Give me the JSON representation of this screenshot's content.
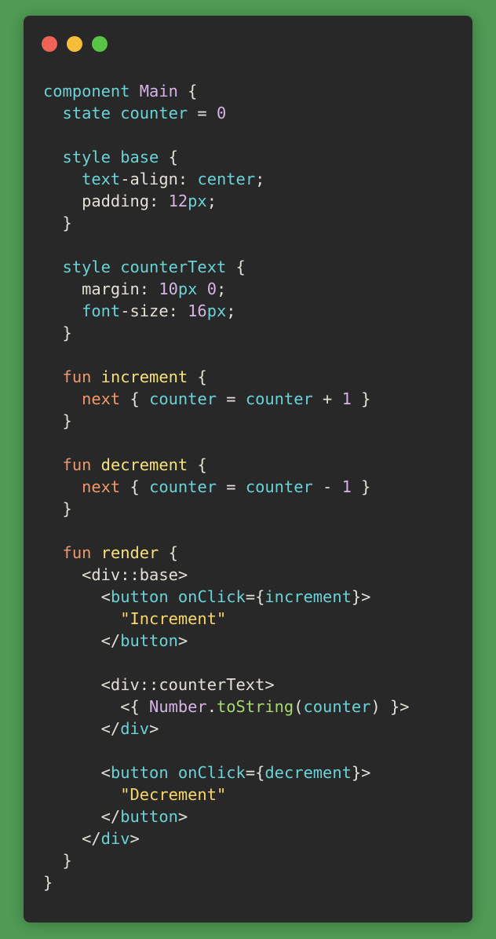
{
  "window": {
    "controls": [
      {
        "name": "close",
        "color": "#ef6257"
      },
      {
        "name": "minimize",
        "color": "#f6bd3a"
      },
      {
        "name": "maximize",
        "color": "#59c545"
      }
    ]
  },
  "code": {
    "language": "mint",
    "lines": [
      [
        {
          "t": "component ",
          "c": "kw"
        },
        {
          "t": "Main",
          "c": "type"
        },
        {
          "t": " {",
          "c": "plain"
        }
      ],
      [
        {
          "t": "  state ",
          "c": "kw"
        },
        {
          "t": "counter",
          "c": "var"
        },
        {
          "t": " = ",
          "c": "plain"
        },
        {
          "t": "0",
          "c": "num"
        }
      ],
      [],
      [
        {
          "t": "  style ",
          "c": "kw"
        },
        {
          "t": "base",
          "c": "var"
        },
        {
          "t": " {",
          "c": "plain"
        }
      ],
      [
        {
          "t": "    text",
          "c": "prop2"
        },
        {
          "t": "-align: ",
          "c": "plain"
        },
        {
          "t": "center",
          "c": "kw"
        },
        {
          "t": ";",
          "c": "plain"
        }
      ],
      [
        {
          "t": "    padding: ",
          "c": "plain"
        },
        {
          "t": "12",
          "c": "num"
        },
        {
          "t": "px",
          "c": "unit"
        },
        {
          "t": ";",
          "c": "plain"
        }
      ],
      [
        {
          "t": "  }",
          "c": "plain"
        }
      ],
      [],
      [
        {
          "t": "  style ",
          "c": "kw"
        },
        {
          "t": "counterText",
          "c": "var"
        },
        {
          "t": " {",
          "c": "plain"
        }
      ],
      [
        {
          "t": "    margin: ",
          "c": "plain"
        },
        {
          "t": "10",
          "c": "num"
        },
        {
          "t": "px",
          "c": "unit"
        },
        {
          "t": " ",
          "c": "plain"
        },
        {
          "t": "0",
          "c": "num"
        },
        {
          "t": ";",
          "c": "plain"
        }
      ],
      [
        {
          "t": "    font",
          "c": "prop2"
        },
        {
          "t": "-size: ",
          "c": "plain"
        },
        {
          "t": "16",
          "c": "num"
        },
        {
          "t": "px",
          "c": "unit"
        },
        {
          "t": ";",
          "c": "plain"
        }
      ],
      [
        {
          "t": "  }",
          "c": "plain"
        }
      ],
      [],
      [
        {
          "t": "  fun ",
          "c": "kw2"
        },
        {
          "t": "increment",
          "c": "fn"
        },
        {
          "t": " {",
          "c": "plain"
        }
      ],
      [
        {
          "t": "    next",
          "c": "kw2"
        },
        {
          "t": " { ",
          "c": "plain"
        },
        {
          "t": "counter",
          "c": "var"
        },
        {
          "t": " = ",
          "c": "plain"
        },
        {
          "t": "counter",
          "c": "var"
        },
        {
          "t": " + ",
          "c": "plain"
        },
        {
          "t": "1",
          "c": "num"
        },
        {
          "t": " }",
          "c": "plain"
        }
      ],
      [
        {
          "t": "  }",
          "c": "plain"
        }
      ],
      [],
      [
        {
          "t": "  fun ",
          "c": "kw2"
        },
        {
          "t": "decrement",
          "c": "fn"
        },
        {
          "t": " {",
          "c": "plain"
        }
      ],
      [
        {
          "t": "    next",
          "c": "kw2"
        },
        {
          "t": " { ",
          "c": "plain"
        },
        {
          "t": "counter",
          "c": "var"
        },
        {
          "t": " = ",
          "c": "plain"
        },
        {
          "t": "counter",
          "c": "var"
        },
        {
          "t": " - ",
          "c": "plain"
        },
        {
          "t": "1",
          "c": "num"
        },
        {
          "t": " }",
          "c": "plain"
        }
      ],
      [
        {
          "t": "  }",
          "c": "plain"
        }
      ],
      [],
      [
        {
          "t": "  fun ",
          "c": "kw2"
        },
        {
          "t": "render",
          "c": "fn"
        },
        {
          "t": " {",
          "c": "plain"
        }
      ],
      [
        {
          "t": "    <div::base>",
          "c": "plain"
        }
      ],
      [
        {
          "t": "      <",
          "c": "plain"
        },
        {
          "t": "button",
          "c": "tag"
        },
        {
          "t": " ",
          "c": "plain"
        },
        {
          "t": "onClick",
          "c": "attr"
        },
        {
          "t": "={",
          "c": "plain"
        },
        {
          "t": "increment",
          "c": "var"
        },
        {
          "t": "}>",
          "c": "plain"
        }
      ],
      [
        {
          "t": "        \"Increment\"",
          "c": "str"
        }
      ],
      [
        {
          "t": "      </",
          "c": "plain"
        },
        {
          "t": "button",
          "c": "tag"
        },
        {
          "t": ">",
          "c": "plain"
        }
      ],
      [],
      [
        {
          "t": "      <div::counterText>",
          "c": "plain"
        }
      ],
      [
        {
          "t": "        <{ ",
          "c": "plain"
        },
        {
          "t": "Number",
          "c": "type"
        },
        {
          "t": ".",
          "c": "plain"
        },
        {
          "t": "toString",
          "c": "method"
        },
        {
          "t": "(",
          "c": "plain"
        },
        {
          "t": "counter",
          "c": "var"
        },
        {
          "t": ") }>",
          "c": "plain"
        }
      ],
      [
        {
          "t": "      </",
          "c": "plain"
        },
        {
          "t": "div",
          "c": "tag"
        },
        {
          "t": ">",
          "c": "plain"
        }
      ],
      [],
      [
        {
          "t": "      <",
          "c": "plain"
        },
        {
          "t": "button",
          "c": "tag"
        },
        {
          "t": " ",
          "c": "plain"
        },
        {
          "t": "onClick",
          "c": "attr"
        },
        {
          "t": "={",
          "c": "plain"
        },
        {
          "t": "decrement",
          "c": "var"
        },
        {
          "t": "}>",
          "c": "plain"
        }
      ],
      [
        {
          "t": "        \"Decrement\"",
          "c": "str"
        }
      ],
      [
        {
          "t": "      </",
          "c": "plain"
        },
        {
          "t": "button",
          "c": "tag"
        },
        {
          "t": ">",
          "c": "plain"
        }
      ],
      [
        {
          "t": "    </",
          "c": "plain"
        },
        {
          "t": "div",
          "c": "tag"
        },
        {
          "t": ">",
          "c": "plain"
        }
      ],
      [
        {
          "t": "  }",
          "c": "plain"
        }
      ],
      [
        {
          "t": "}",
          "c": "plain"
        }
      ]
    ]
  },
  "colors": {
    "background": "#4f9a54",
    "window": "#282828",
    "keyword": "#6ad2d6",
    "keyword_alt": "#f0976a",
    "function": "#f7e17a",
    "string": "#f7d76a",
    "number": "#d5b3e6",
    "method": "#a6d86f",
    "text": "#e3dfd6"
  }
}
